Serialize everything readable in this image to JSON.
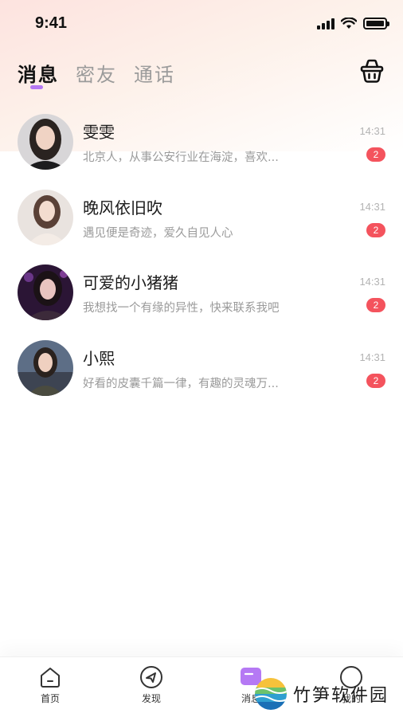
{
  "status_bar": {
    "time": "9:41"
  },
  "header": {
    "tabs": [
      {
        "label": "消息",
        "active": true
      },
      {
        "label": "密友",
        "active": false
      },
      {
        "label": "通话",
        "active": false
      }
    ],
    "basket_icon": "basket-icon"
  },
  "conversations": [
    {
      "name": "雯雯",
      "preview": "北京人，从事公安行业在海淀，喜欢...",
      "time": "14:31",
      "unread": "2"
    },
    {
      "name": "晚风依旧吹",
      "preview": "遇见便是奇迹，爱久自见人心",
      "time": "14:31",
      "unread": "2"
    },
    {
      "name": "可爱的小猪猪",
      "preview": "我想找一个有缘的异性，快来联系我吧",
      "time": "14:31",
      "unread": "2"
    },
    {
      "name": "小熙",
      "preview": "好看的皮囊千篇一律，有趣的灵魂万...",
      "time": "14:31",
      "unread": "2"
    }
  ],
  "tabbar": {
    "items": [
      {
        "label": "首页",
        "icon": "home-icon"
      },
      {
        "label": "发现",
        "icon": "compass-icon"
      },
      {
        "label": "消息",
        "icon": "message-icon",
        "active": true
      },
      {
        "label": "我的",
        "icon": "profile-icon"
      }
    ]
  },
  "watermark": {
    "text": "竹笋软件园"
  },
  "colors": {
    "accent": "#b579f4",
    "badge": "#f4535d",
    "muted_text": "#9a9a9a"
  }
}
